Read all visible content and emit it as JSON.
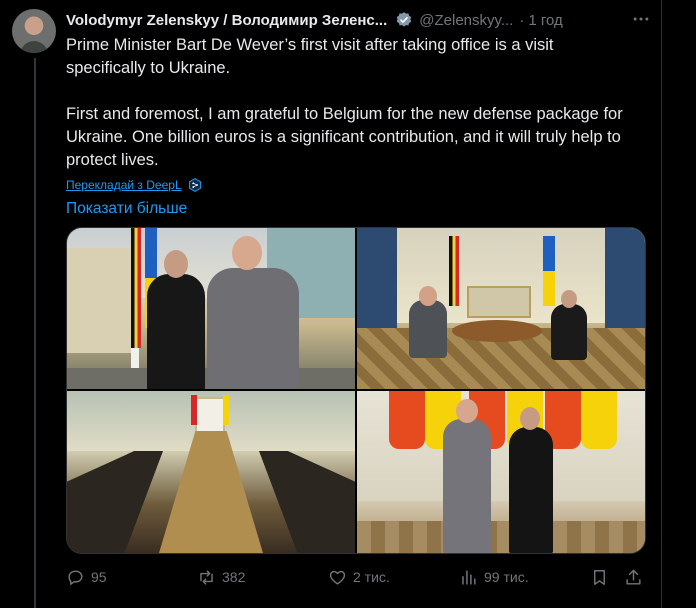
{
  "post": {
    "author_name": "Volodymyr Zelenskyy / Володимир Зеленс...",
    "handle": "@Zelenskyy...",
    "separator": "·",
    "time": "1 год",
    "paragraph_1": "Prime Minister Bart De Wever’s first visit after taking office is a visit specifically to Ukraine.",
    "paragraph_2": "First and foremost, I am grateful to Belgium for the new defense package for Ukraine. One billion euros is a significant contribution, and it will truly help to protect lives.",
    "translate_link": "Перекладай з DeepL",
    "show_more": "Показати більше"
  },
  "actions": {
    "replies": "95",
    "reposts": "382",
    "likes": "2 тис.",
    "views": "99 тис."
  },
  "colors": {
    "accent": "#1d9bf0",
    "muted": "#71767b",
    "text": "#e7e9ea",
    "background": "#000000"
  },
  "icons": {
    "verified": "verified-badge-icon",
    "more": "more-icon",
    "deepl": "deepl-icon",
    "reply": "reply-icon",
    "repost": "repost-icon",
    "like": "heart-icon",
    "views": "analytics-icon",
    "bookmark": "bookmark-icon",
    "share": "share-icon"
  }
}
